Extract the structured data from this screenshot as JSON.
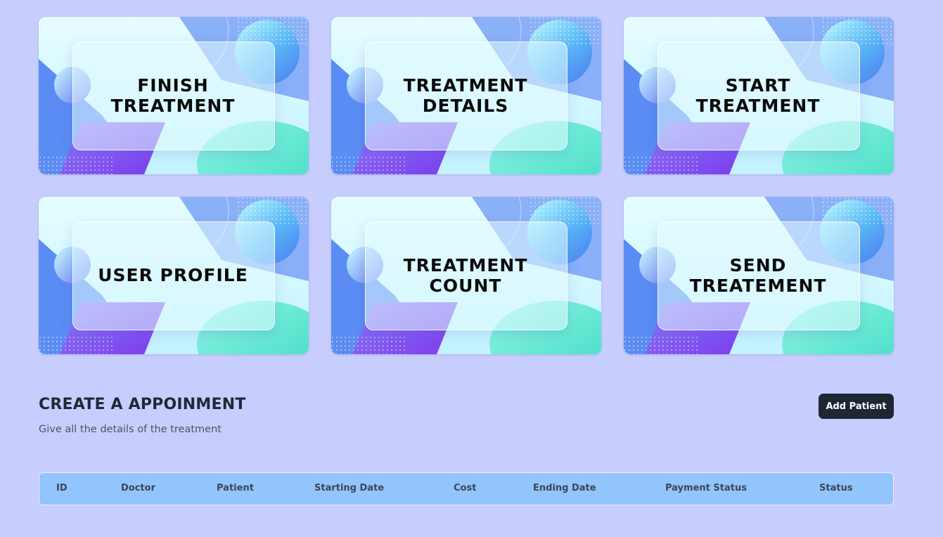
{
  "cards": [
    {
      "label": "FINISH\nTREATMENT"
    },
    {
      "label": "TREATMENT\nDETAILS"
    },
    {
      "label": "START\nTREATMENT"
    },
    {
      "label": "USER PROFILE"
    },
    {
      "label": "TREATMENT\nCOUNT"
    },
    {
      "label": "SEND\nTREATEMENT"
    }
  ],
  "section": {
    "title": "CREATE A APPOINMENT",
    "subtitle": "Give all the details of the treatment",
    "add_button_label": "Add Patient"
  },
  "table": {
    "columns": [
      "ID",
      "Doctor",
      "Patient",
      "Starting Date",
      "Cost",
      "Ending Date",
      "Payment Status",
      "Status"
    ],
    "rows": []
  },
  "colors": {
    "page_background": "#c7cdfd",
    "button_background": "#1f2733",
    "table_header_background": "#93c5fd"
  }
}
